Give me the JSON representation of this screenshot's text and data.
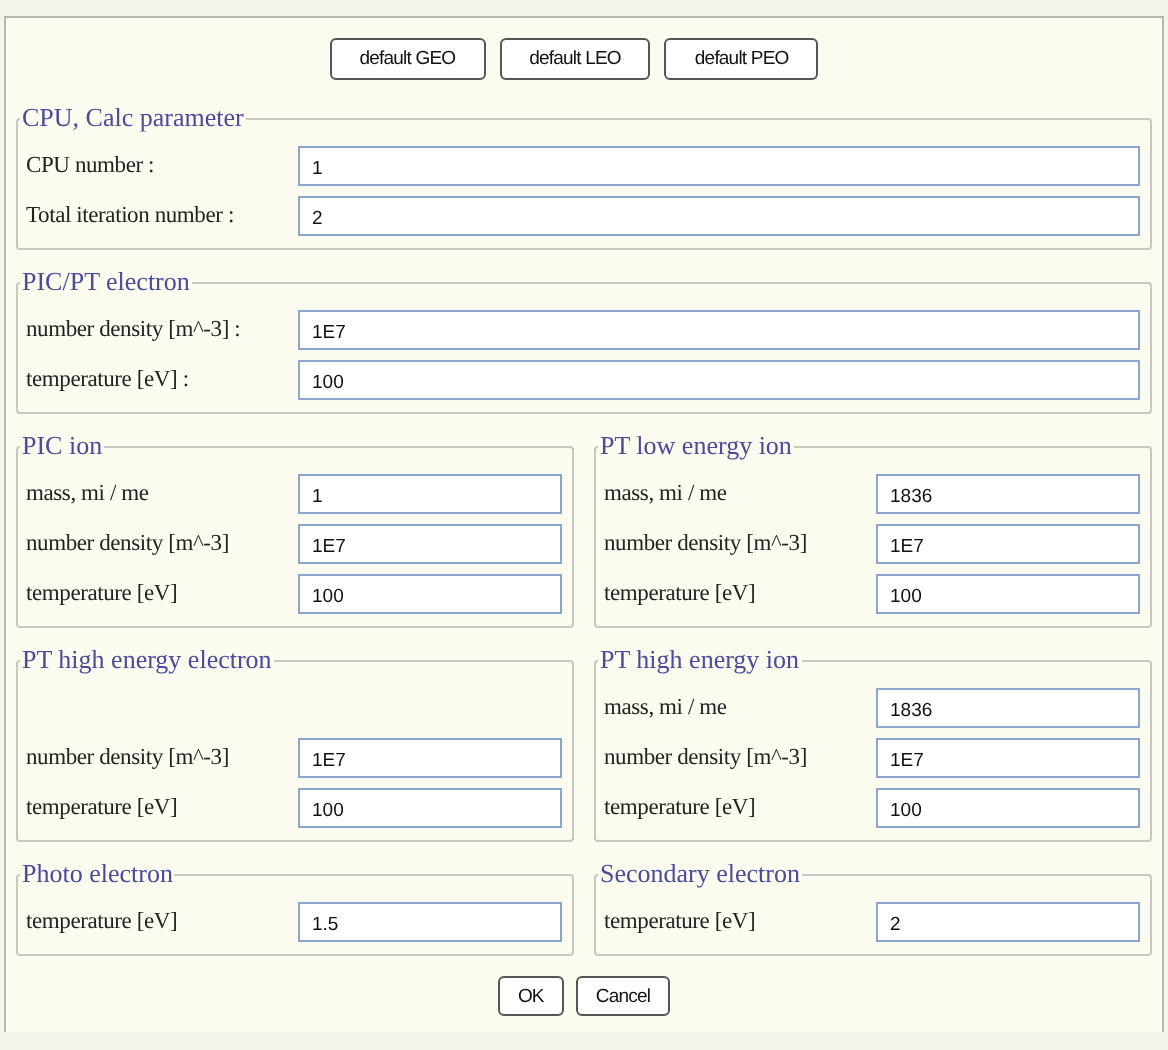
{
  "top_buttons": [
    "default GEO",
    "default LEO",
    "default PEO"
  ],
  "sections": [
    {
      "groups": [
        {
          "title": "CPU, Calc parameter",
          "rows": [
            {
              "kind": "field",
              "label": "CPU number :",
              "value": "1"
            },
            {
              "kind": "field",
              "label": "Total iteration number :",
              "value": "2"
            }
          ]
        }
      ]
    },
    {
      "groups": [
        {
          "title": "PIC/PT electron",
          "rows": [
            {
              "kind": "field",
              "label": "number density [m^-3] :",
              "value": "1E7"
            },
            {
              "kind": "field",
              "label": "temperature [eV] :",
              "value": "100"
            }
          ]
        }
      ]
    },
    {
      "groups": [
        {
          "title": "PIC ion",
          "rows": [
            {
              "kind": "field",
              "label": "mass, mi / me",
              "value": "1"
            },
            {
              "kind": "field",
              "label": "number density [m^-3]",
              "value": "1E7"
            },
            {
              "kind": "field",
              "label": "temperature [eV]",
              "value": "100"
            }
          ]
        },
        {
          "title": "PT low energy ion",
          "rows": [
            {
              "kind": "field",
              "label": "mass, mi / me",
              "value": "1836"
            },
            {
              "kind": "field",
              "label": "number density [m^-3]",
              "value": "1E7"
            },
            {
              "kind": "field",
              "label": "temperature [eV]",
              "value": "100"
            }
          ]
        }
      ]
    },
    {
      "groups": [
        {
          "title": "PT high energy electron",
          "rows": [
            {
              "kind": "spacer"
            },
            {
              "kind": "field",
              "label": "number density [m^-3]",
              "value": "1E7"
            },
            {
              "kind": "field",
              "label": "temperature [eV]",
              "value": "100"
            }
          ]
        },
        {
          "title": "PT high energy ion",
          "rows": [
            {
              "kind": "field",
              "label": "mass, mi / me",
              "value": "1836"
            },
            {
              "kind": "field",
              "label": "number density [m^-3]",
              "value": "1E7"
            },
            {
              "kind": "field",
              "label": "temperature [eV]",
              "value": "100"
            }
          ]
        }
      ]
    },
    {
      "groups": [
        {
          "title": "Photo electron",
          "rows": [
            {
              "kind": "field",
              "label": "temperature [eV]",
              "value": "1.5"
            }
          ]
        },
        {
          "title": "Secondary electron",
          "rows": [
            {
              "kind": "field",
              "label": "temperature [eV]",
              "value": "2"
            }
          ]
        }
      ]
    }
  ],
  "bottom_buttons": [
    "OK",
    "Cancel"
  ]
}
